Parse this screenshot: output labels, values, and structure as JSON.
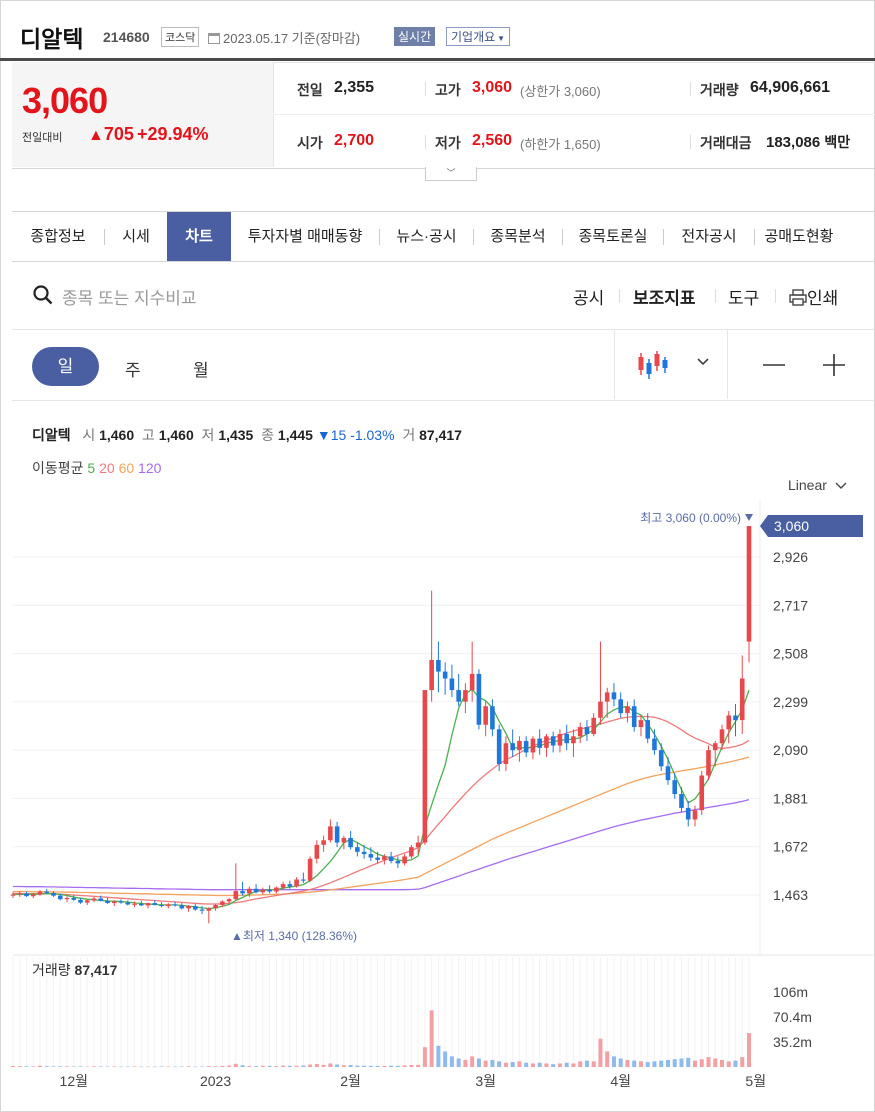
{
  "header": {
    "name": "디알텍",
    "code": "214680",
    "market": "코스닥",
    "date": "2023.05.17 기준(장마감)",
    "realtime": "실시간",
    "company": "기업개요"
  },
  "quote": {
    "price": "3,060",
    "change_label": "전일대비",
    "change": "705",
    "change_pct": "+29.94%",
    "prev_label": "전일",
    "prev": "2,355",
    "open_label": "시가",
    "open": "2,700",
    "high_label": "고가",
    "high": "3,060",
    "high_sub": "(상한가 3,060)",
    "low_label": "저가",
    "low": "2,560",
    "low_sub": "(하한가 1,650)",
    "vol_label": "거래량",
    "vol": "64,906,661",
    "amt_label": "거래대금",
    "amt": "183,086",
    "amt_unit": "백만"
  },
  "tabs": [
    "종합정보",
    "시세",
    "차트",
    "투자자별 매매동향",
    "뉴스·공시",
    "종목분석",
    "종목토론실",
    "전자공시",
    "공매도현황"
  ],
  "toolbar": {
    "search_placeholder": "종목 또는 지수비교",
    "disclosure": "공시",
    "indicators": "보조지표",
    "tools": "도구",
    "print": "인쇄"
  },
  "periods": {
    "day": "일",
    "week": "주",
    "month": "월"
  },
  "info": {
    "name": "디알텍",
    "o_k": "시",
    "o": "1,460",
    "h_k": "고",
    "h": "1,460",
    "l_k": "저",
    "l": "1,435",
    "c_k": "종",
    "c": "1,445",
    "chg": "▼15 -1.03%",
    "v_k": "거",
    "v": "87,417"
  },
  "ma_legend": {
    "label": "이동평균",
    "p5": "5",
    "p20": "20",
    "p60": "60",
    "p120": "120"
  },
  "colors": {
    "up": "#e8474c",
    "down": "#1f77d9",
    "ma5": "#4caf50",
    "ma20": "#ef7b7b",
    "ma60": "#f3a35c",
    "ma120": "#a66cf0",
    "accent": "#4a5fa1"
  },
  "chart_data": {
    "type": "candlestick",
    "scale": "Linear",
    "y_ticks": [
      1463,
      1672,
      1881,
      2090,
      2299,
      2508,
      2717,
      2926
    ],
    "y_tick_labels": [
      "1,463",
      "1,672",
      "1,881",
      "2,090",
      "2,299",
      "2,508",
      "2,717",
      "2,926"
    ],
    "current_label": "3,060",
    "high_annotation": "최고 3,060 (0.00%)",
    "low_annotation": "최저 1,340 (128.36%)",
    "x_labels": [
      "12월",
      "2023",
      "2월",
      "3월",
      "4월",
      "5월"
    ],
    "x_label_index": [
      9,
      30,
      50,
      70,
      90,
      110
    ],
    "volume_label": "거래량",
    "volume_value": "87,417",
    "volume_ticks": [
      "106m",
      "70.4m",
      "35.2m"
    ],
    "volume_tick_values": [
      106,
      70.4,
      35.2
    ],
    "ohlc": [
      [
        1460,
        1475,
        1450,
        1465
      ],
      [
        1465,
        1480,
        1455,
        1470
      ],
      [
        1470,
        1478,
        1455,
        1458
      ],
      [
        1458,
        1470,
        1450,
        1465
      ],
      [
        1465,
        1485,
        1460,
        1478
      ],
      [
        1478,
        1490,
        1468,
        1472
      ],
      [
        1472,
        1480,
        1455,
        1460
      ],
      [
        1460,
        1468,
        1440,
        1445
      ],
      [
        1445,
        1458,
        1432,
        1450
      ],
      [
        1450,
        1462,
        1438,
        1442
      ],
      [
        1442,
        1450,
        1425,
        1430
      ],
      [
        1430,
        1445,
        1420,
        1440
      ],
      [
        1440,
        1455,
        1432,
        1448
      ],
      [
        1448,
        1460,
        1435,
        1438
      ],
      [
        1438,
        1450,
        1425,
        1428
      ],
      [
        1428,
        1440,
        1415,
        1435
      ],
      [
        1435,
        1445,
        1425,
        1430
      ],
      [
        1430,
        1440,
        1418,
        1422
      ],
      [
        1422,
        1435,
        1410,
        1425
      ],
      [
        1425,
        1438,
        1415,
        1418
      ],
      [
        1418,
        1430,
        1405,
        1428
      ],
      [
        1428,
        1440,
        1418,
        1420
      ],
      [
        1420,
        1432,
        1410,
        1415
      ],
      [
        1415,
        1428,
        1405,
        1422
      ],
      [
        1422,
        1435,
        1412,
        1418
      ],
      [
        1418,
        1428,
        1400,
        1405
      ],
      [
        1405,
        1420,
        1390,
        1415
      ],
      [
        1415,
        1425,
        1395,
        1400
      ],
      [
        1400,
        1415,
        1380,
        1395
      ],
      [
        1395,
        1410,
        1340,
        1405
      ],
      [
        1405,
        1425,
        1395,
        1420
      ],
      [
        1420,
        1440,
        1410,
        1435
      ],
      [
        1435,
        1450,
        1425,
        1445
      ],
      [
        1445,
        1600,
        1440,
        1480
      ],
      [
        1480,
        1520,
        1460,
        1470
      ],
      [
        1470,
        1500,
        1455,
        1490
      ],
      [
        1490,
        1510,
        1470,
        1475
      ],
      [
        1475,
        1495,
        1465,
        1485
      ],
      [
        1485,
        1505,
        1470,
        1478
      ],
      [
        1478,
        1500,
        1470,
        1495
      ],
      [
        1495,
        1520,
        1485,
        1510
      ],
      [
        1510,
        1525,
        1490,
        1500
      ],
      [
        1500,
        1540,
        1495,
        1530
      ],
      [
        1530,
        1560,
        1515,
        1525
      ],
      [
        1525,
        1630,
        1520,
        1620
      ],
      [
        1620,
        1700,
        1600,
        1680
      ],
      [
        1680,
        1720,
        1650,
        1700
      ],
      [
        1700,
        1790,
        1690,
        1760
      ],
      [
        1760,
        1780,
        1670,
        1690
      ],
      [
        1690,
        1720,
        1660,
        1710
      ],
      [
        1710,
        1740,
        1660,
        1670
      ],
      [
        1670,
        1690,
        1630,
        1650
      ],
      [
        1650,
        1680,
        1620,
        1640
      ],
      [
        1640,
        1670,
        1610,
        1625
      ],
      [
        1625,
        1650,
        1600,
        1615
      ],
      [
        1615,
        1640,
        1595,
        1630
      ],
      [
        1630,
        1650,
        1600,
        1610
      ],
      [
        1610,
        1630,
        1580,
        1600
      ],
      [
        1600,
        1640,
        1590,
        1630
      ],
      [
        1630,
        1680,
        1620,
        1670
      ],
      [
        1670,
        1720,
        1640,
        1690
      ],
      [
        1690,
        1820,
        1680,
        2350
      ],
      [
        2350,
        2780,
        2300,
        2480
      ],
      [
        2480,
        2560,
        2340,
        2430
      ],
      [
        2430,
        2470,
        2330,
        2400
      ],
      [
        2400,
        2460,
        2320,
        2350
      ],
      [
        2350,
        2420,
        2280,
        2300
      ],
      [
        2300,
        2380,
        2250,
        2350
      ],
      [
        2350,
        2560,
        2300,
        2420
      ],
      [
        2420,
        2440,
        2180,
        2200
      ],
      [
        2200,
        2300,
        2150,
        2280
      ],
      [
        2280,
        2310,
        2150,
        2180
      ],
      [
        2180,
        2200,
        2000,
        2030
      ],
      [
        2030,
        2150,
        2000,
        2120
      ],
      [
        2120,
        2180,
        2060,
        2090
      ],
      [
        2090,
        2150,
        2040,
        2130
      ],
      [
        2130,
        2150,
        2060,
        2080
      ],
      [
        2080,
        2150,
        2050,
        2140
      ],
      [
        2140,
        2180,
        2070,
        2100
      ],
      [
        2100,
        2160,
        2060,
        2150
      ],
      [
        2150,
        2170,
        2080,
        2110
      ],
      [
        2110,
        2180,
        2080,
        2160
      ],
      [
        2160,
        2200,
        2090,
        2120
      ],
      [
        2120,
        2180,
        2060,
        2150
      ],
      [
        2150,
        2210,
        2120,
        2190
      ],
      [
        2190,
        2220,
        2130,
        2160
      ],
      [
        2160,
        2250,
        2150,
        2230
      ],
      [
        2230,
        2560,
        2200,
        2300
      ],
      [
        2300,
        2360,
        2230,
        2340
      ],
      [
        2340,
        2380,
        2280,
        2310
      ],
      [
        2310,
        2340,
        2230,
        2250
      ],
      [
        2250,
        2300,
        2210,
        2280
      ],
      [
        2280,
        2310,
        2170,
        2190
      ],
      [
        2190,
        2240,
        2150,
        2220
      ],
      [
        2220,
        2250,
        2120,
        2140
      ],
      [
        2140,
        2180,
        2070,
        2090
      ],
      [
        2090,
        2120,
        2000,
        2020
      ],
      [
        2020,
        2060,
        1940,
        1960
      ],
      [
        1960,
        1990,
        1880,
        1900
      ],
      [
        1900,
        1930,
        1820,
        1840
      ],
      [
        1840,
        1870,
        1760,
        1790
      ],
      [
        1790,
        1850,
        1760,
        1830
      ],
      [
        1830,
        2000,
        1810,
        1980
      ],
      [
        1980,
        2110,
        1960,
        2090
      ],
      [
        2090,
        2130,
        2020,
        2120
      ],
      [
        2120,
        2200,
        2090,
        2180
      ],
      [
        2180,
        2260,
        2120,
        2240
      ],
      [
        2240,
        2290,
        2150,
        2220
      ],
      [
        2220,
        2500,
        2160,
        2400
      ],
      [
        2560,
        3060,
        2470,
        3060
      ]
    ],
    "ma5": [
      1465,
      1466,
      1466,
      1466,
      1467,
      1469,
      1468,
      1465,
      1461,
      1454,
      1449,
      1445,
      1442,
      1440,
      1437,
      1436,
      1435,
      1432,
      1429,
      1426,
      1424,
      1422,
      1420,
      1420,
      1420,
      1418,
      1415,
      1411,
      1407,
      1404,
      1408,
      1414,
      1422,
      1439,
      1452,
      1467,
      1478,
      1483,
      1485,
      1486,
      1493,
      1497,
      1502,
      1508,
      1525,
      1547,
      1577,
      1608,
      1647,
      1689,
      1704,
      1690,
      1672,
      1658,
      1640,
      1630,
      1624,
      1614,
      1611,
      1615,
      1632,
      1762,
      1852,
      1941,
      2024,
      2155,
      2272,
      2334,
      2354,
      2318,
      2304,
      2273,
      2215,
      2163,
      2100,
      2100,
      2100,
      2103,
      2108,
      2120,
      2126,
      2132,
      2136,
      2138,
      2144,
      2160,
      2178,
      2212,
      2246,
      2264,
      2276,
      2278,
      2256,
      2242,
      2204,
      2158,
      2108,
      2050,
      1984,
      1919,
      1862,
      1879,
      1920,
      1965,
      2034,
      2104,
      2165,
      2214,
      2265,
      2350
    ],
    "ma20": [
      1470,
      1470,
      1469,
      1469,
      1469,
      1469,
      1468,
      1467,
      1465,
      1463,
      1461,
      1459,
      1457,
      1455,
      1453,
      1451,
      1449,
      1447,
      1445,
      1443,
      1441,
      1439,
      1437,
      1435,
      1433,
      1431,
      1429,
      1427,
      1425,
      1424,
      1424,
      1425,
      1427,
      1430,
      1434,
      1440,
      1446,
      1451,
      1456,
      1461,
      1466,
      1470,
      1475,
      1480,
      1487,
      1495,
      1505,
      1516,
      1528,
      1540,
      1552,
      1565,
      1577,
      1589,
      1601,
      1613,
      1624,
      1635,
      1645,
      1655,
      1668,
      1700,
      1735,
      1770,
      1802,
      1838,
      1870,
      1902,
      1932,
      1960,
      1985,
      2008,
      2030,
      2048,
      2062,
      2078,
      2094,
      2108,
      2120,
      2132,
      2143,
      2154,
      2164,
      2173,
      2181,
      2188,
      2195,
      2203,
      2212,
      2220,
      2228,
      2233,
      2235,
      2236,
      2235,
      2232,
      2224,
      2212,
      2196,
      2178,
      2158,
      2142,
      2130,
      2118,
      2102,
      2098,
      2100,
      2106,
      2115,
      2132
    ],
    "ma60": [
      1478,
      1478,
      1478,
      1477,
      1477,
      1477,
      1476,
      1476,
      1475,
      1475,
      1474,
      1474,
      1473,
      1472,
      1472,
      1471,
      1470,
      1470,
      1469,
      1468,
      1468,
      1467,
      1466,
      1466,
      1465,
      1464,
      1464,
      1463,
      1462,
      1462,
      1461,
      1461,
      1461,
      1461,
      1462,
      1462,
      1463,
      1464,
      1465,
      1466,
      1467,
      1469,
      1471,
      1473,
      1475,
      1478,
      1481,
      1485,
      1489,
      1493,
      1497,
      1501,
      1505,
      1509,
      1513,
      1517,
      1521,
      1525,
      1530,
      1535,
      1540,
      1555,
      1570,
      1585,
      1600,
      1615,
      1630,
      1645,
      1660,
      1675,
      1690,
      1705,
      1718,
      1730,
      1742,
      1754,
      1766,
      1778,
      1790,
      1802,
      1814,
      1826,
      1838,
      1850,
      1862,
      1874,
      1886,
      1898,
      1910,
      1922,
      1934,
      1945,
      1955,
      1964,
      1972,
      1979,
      1985,
      1990,
      1995,
      2000,
      2005,
      2010,
      2015,
      2020,
      2026,
      2032,
      2038,
      2045,
      2052,
      2060
    ],
    "ma120": [
      1500,
      1500,
      1499,
      1499,
      1499,
      1498,
      1498,
      1497,
      1497,
      1496,
      1496,
      1495,
      1495,
      1494,
      1494,
      1493,
      1493,
      1492,
      1492,
      1491,
      1491,
      1490,
      1490,
      1489,
      1489,
      1488,
      1488,
      1487,
      1487,
      1486,
      1486,
      1486,
      1486,
      1486,
      1486,
      1486,
      1486,
      1486,
      1486,
      1486,
      1486,
      1486,
      1486,
      1486,
      1486,
      1486,
      1486,
      1486,
      1486,
      1486,
      1486,
      1486,
      1486,
      1486,
      1486,
      1486,
      1486,
      1486,
      1486,
      1487,
      1488,
      1495,
      1505,
      1515,
      1525,
      1535,
      1545,
      1555,
      1565,
      1575,
      1585,
      1595,
      1605,
      1615,
      1624,
      1633,
      1642,
      1651,
      1660,
      1669,
      1678,
      1687,
      1696,
      1705,
      1714,
      1723,
      1732,
      1741,
      1750,
      1758,
      1766,
      1773,
      1780,
      1787,
      1793,
      1799,
      1805,
      1811,
      1817,
      1822,
      1827,
      1832,
      1837,
      1842,
      1847,
      1852,
      1857,
      1862,
      1868,
      1876
    ],
    "volume": [
      1.5,
      1.2,
      1.0,
      0.9,
      1.8,
      1.1,
      0.8,
      1.0,
      0.9,
      0.7,
      0.8,
      0.6,
      0.9,
      0.7,
      0.6,
      0.8,
      0.5,
      0.6,
      0.7,
      0.5,
      0.6,
      0.5,
      0.7,
      0.6,
      0.5,
      0.6,
      0.9,
      0.5,
      0.6,
      1.2,
      1.0,
      1.5,
      2.0,
      4.5,
      2.5,
      1.5,
      1.2,
      1.8,
      1.5,
      1.3,
      2.0,
      1.6,
      1.8,
      2.2,
      3.5,
      4.2,
      3.0,
      5.0,
      3.5,
      2.5,
      2.8,
      2.0,
      1.8,
      1.6,
      1.5,
      1.4,
      1.8,
      1.6,
      2.2,
      2.8,
      3.0,
      28,
      80,
      30,
      22,
      15,
      12,
      10,
      15,
      12,
      9,
      10,
      8,
      6,
      7,
      8,
      6,
      5,
      6,
      5,
      4,
      5,
      6,
      5,
      8,
      9,
      8,
      40,
      22,
      15,
      12,
      10,
      9,
      8,
      7,
      8,
      9,
      10,
      11,
      12,
      13,
      9,
      11,
      14,
      12,
      10,
      8,
      9,
      14,
      48
    ]
  }
}
